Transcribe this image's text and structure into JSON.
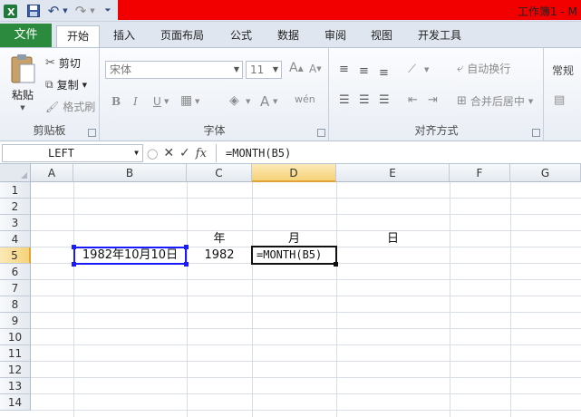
{
  "window": {
    "title": "工作簿1 - M"
  },
  "qat": {
    "undo": "↶",
    "redo": "↷"
  },
  "tabs": [
    {
      "label": "文件"
    },
    {
      "label": "开始"
    },
    {
      "label": "插入"
    },
    {
      "label": "页面布局"
    },
    {
      "label": "公式"
    },
    {
      "label": "数据"
    },
    {
      "label": "审阅"
    },
    {
      "label": "视图"
    },
    {
      "label": "开发工具"
    }
  ],
  "ribbon": {
    "clipboard": {
      "label": "剪贴板",
      "paste": "粘贴",
      "cut": "剪切",
      "copy": "复制",
      "format_painter": "格式刷"
    },
    "font": {
      "label": "字体",
      "font_name": "宋体",
      "font_size": "11",
      "bold": "B",
      "italic": "I",
      "underline": "U"
    },
    "alignment": {
      "label": "对齐方式",
      "wrap_text": "自动换行",
      "merge_center": "合并后居中"
    },
    "number": {
      "format": "常规"
    }
  },
  "formula_bar": {
    "name_box": "LEFT",
    "fx": "fx",
    "formula": "=MONTH(B5)"
  },
  "grid": {
    "columns": [
      "A",
      "B",
      "C",
      "D",
      "E",
      "F",
      "G"
    ],
    "rows": [
      "1",
      "2",
      "3",
      "4",
      "5",
      "6",
      "7",
      "8",
      "9",
      "10",
      "11",
      "12",
      "13",
      "14"
    ],
    "selected_column": "D",
    "selected_row": "5"
  },
  "cells": {
    "C4": "年",
    "D4": "月",
    "E4": "日",
    "B5": "1982年10月10日",
    "C5": "1982",
    "D5": "=MONTH(B5)"
  },
  "colors": {
    "file_tab": "#2b8a3e",
    "title_highlight": "#f20000",
    "ref_border": "#1a1aff",
    "selection": "#f6d37a"
  }
}
